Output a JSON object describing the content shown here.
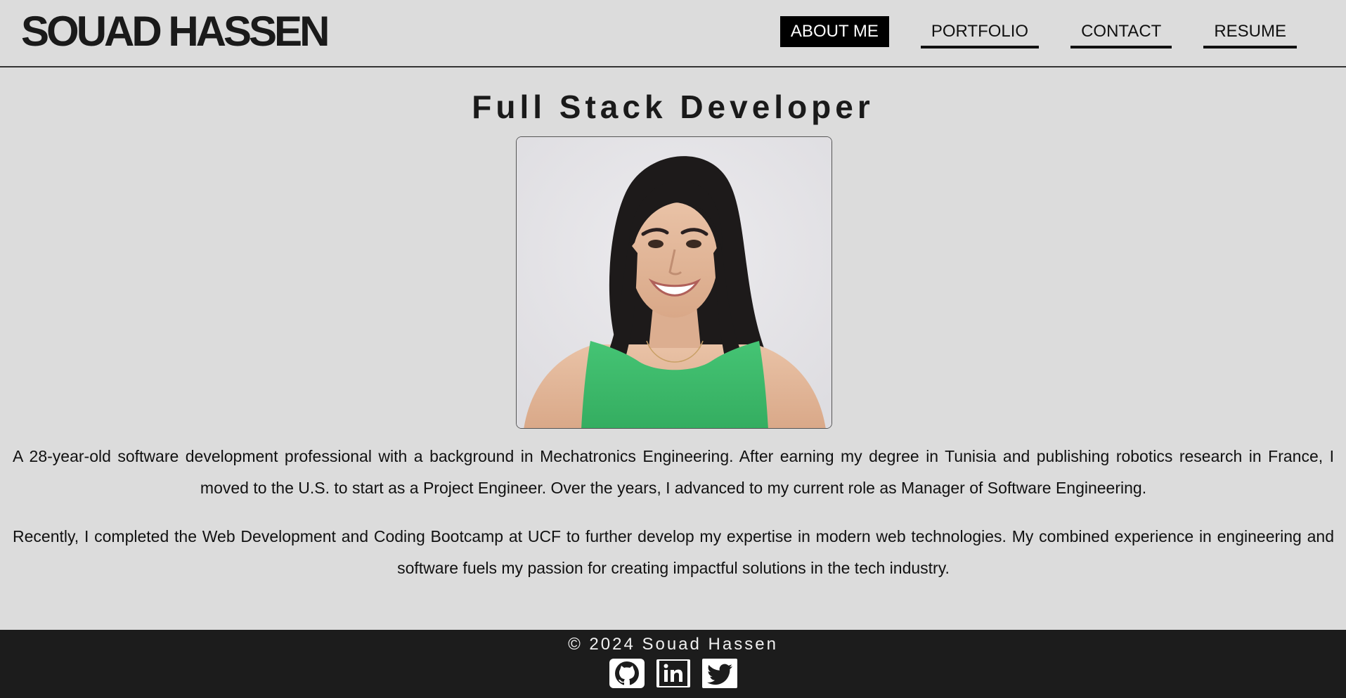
{
  "header": {
    "site_name": "SOUAD HASSEN",
    "nav": [
      {
        "label": "ABOUT ME",
        "active": true
      },
      {
        "label": "PORTFOLIO",
        "active": false
      },
      {
        "label": "CONTACT",
        "active": false
      },
      {
        "label": "RESUME",
        "active": false
      }
    ]
  },
  "main": {
    "title": "Full Stack Developer",
    "bio": [
      "A 28-year-old software development professional with a background in Mechatronics Engineering. After earning my degree in Tunisia and publishing robotics research in France, I moved to the U.S. to start as a Project Engineer. Over the years, I advanced to my current role as Manager of Software Engineering.",
      "Recently, I completed the Web Development and Coding Bootcamp at UCF to further develop my expertise in modern web technologies. My combined experience in engineering and software fuels my passion for creating impactful solutions in the tech industry."
    ]
  },
  "footer": {
    "copyright": "© 2024 Souad Hassen",
    "socials": [
      {
        "name": "github-icon"
      },
      {
        "name": "linkedin-icon"
      },
      {
        "name": "twitter-icon"
      }
    ]
  },
  "colors": {
    "background": "#dcdcdc",
    "footer": "#1c1c1c",
    "accent": "#000000",
    "shirt_green": "#3dba6a"
  }
}
